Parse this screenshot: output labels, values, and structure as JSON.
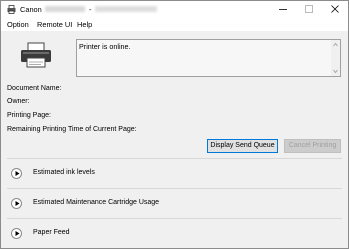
{
  "window": {
    "app_name": "Canon",
    "title_separator": "-"
  },
  "menu": {
    "option": "Option",
    "remote_ui": "Remote UI",
    "help": "Help"
  },
  "status": {
    "message": "Printer is online."
  },
  "job_info": {
    "document_name_label": "Document Name:",
    "owner_label": "Owner:",
    "printing_page_label": "Printing Page:",
    "remaining_time_label": "Remaining Printing Time of Current Page:"
  },
  "buttons": {
    "display_send_queue": "Display Send Queue",
    "cancel_printing": "Cancel Printing"
  },
  "sections": [
    {
      "label": "Estimated ink levels"
    },
    {
      "label": "Estimated Maintenance Cartridge Usage"
    },
    {
      "label": "Paper Feed"
    }
  ],
  "colors": {
    "focus_border": "#0078d7",
    "window_bg": "#f0f0f0",
    "disabled_text": "#a0a0a0"
  }
}
